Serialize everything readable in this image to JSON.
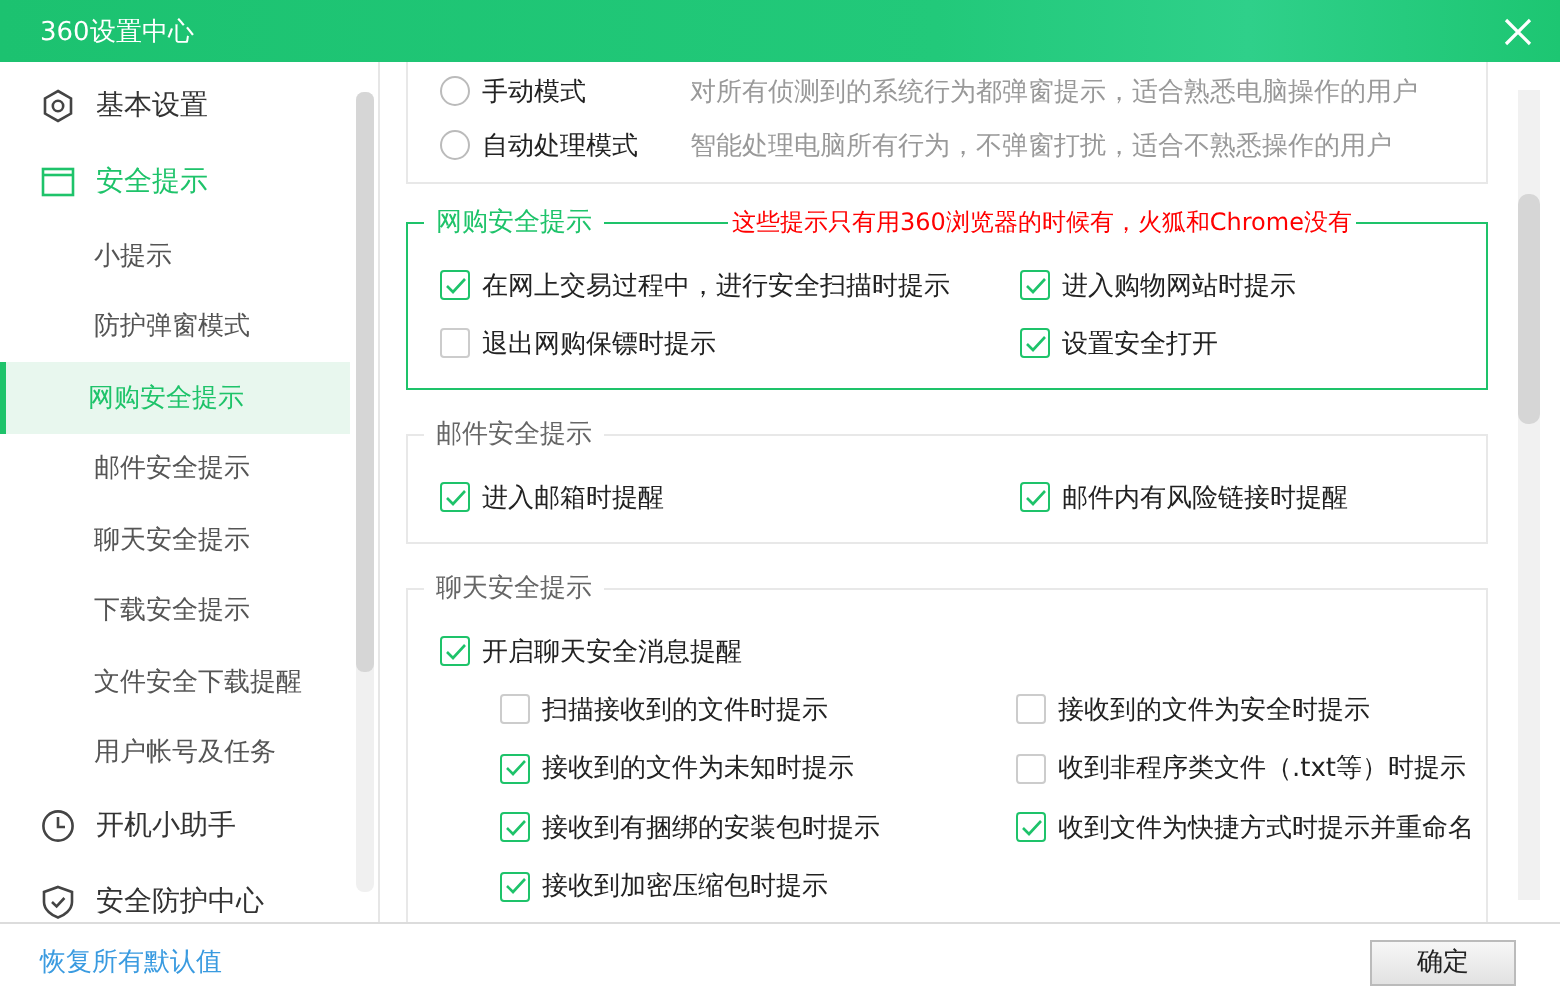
{
  "window": {
    "title": "360设置中心"
  },
  "sidebar": {
    "items": [
      {
        "label": "基本设置",
        "selected": false
      },
      {
        "label": "安全提示",
        "selected": true,
        "children": [
          {
            "label": "小提示",
            "selected": false
          },
          {
            "label": "防护弹窗模式",
            "selected": false
          },
          {
            "label": "网购安全提示",
            "selected": true
          },
          {
            "label": "邮件安全提示",
            "selected": false
          },
          {
            "label": "聊天安全提示",
            "selected": false
          },
          {
            "label": "下载安全提示",
            "selected": false
          },
          {
            "label": "文件安全下载提醒",
            "selected": false
          },
          {
            "label": "用户帐号及任务",
            "selected": false
          }
        ]
      },
      {
        "label": "开机小助手",
        "selected": false
      },
      {
        "label": "安全防护中心",
        "selected": false
      }
    ]
  },
  "mode_options": [
    {
      "label": "手动模式",
      "description": "对所有侦测到的系统行为都弹窗提示，适合熟悉电脑操作的用户",
      "selected": false
    },
    {
      "label": "自动处理模式",
      "description": "智能处理电脑所有行为，不弹窗打扰，适合不熟悉操作的用户",
      "selected": false
    }
  ],
  "sections": [
    {
      "title": "网购安全提示",
      "highlighted": true,
      "note": "这些提示只有用360浏览器的时候有，火狐和Chrome没有",
      "options": [
        {
          "label": "在网上交易过程中，进行安全扫描时提示",
          "checked": true
        },
        {
          "label": "进入购物网站时提示",
          "checked": true
        },
        {
          "label": "退出网购保镖时提示",
          "checked": false
        },
        {
          "label": "设置安全打开",
          "checked": true
        }
      ]
    },
    {
      "title": "邮件安全提示",
      "highlighted": false,
      "options": [
        {
          "label": "进入邮箱时提醒",
          "checked": true
        },
        {
          "label": "邮件内有风险链接时提醒",
          "checked": true
        }
      ]
    },
    {
      "title": "聊天安全提示",
      "highlighted": false,
      "master": {
        "label": "开启聊天安全消息提醒",
        "checked": true
      },
      "options": [
        {
          "label": "扫描接收到的文件时提示",
          "checked": false
        },
        {
          "label": "接收到的文件为安全时提示",
          "checked": false
        },
        {
          "label": "接收到的文件为未知时提示",
          "checked": true
        },
        {
          "label": "收到非程序类文件（.txt等）时提示",
          "checked": false
        },
        {
          "label": "接收到有捆绑的安装包时提示",
          "checked": true
        },
        {
          "label": "收到文件为快捷方式时提示并重命名",
          "checked": true
        },
        {
          "label": "接收到加密压缩包时提示",
          "checked": true
        }
      ]
    }
  ],
  "footer": {
    "restore_link": "恢复所有默认值",
    "ok_button": "确定"
  }
}
